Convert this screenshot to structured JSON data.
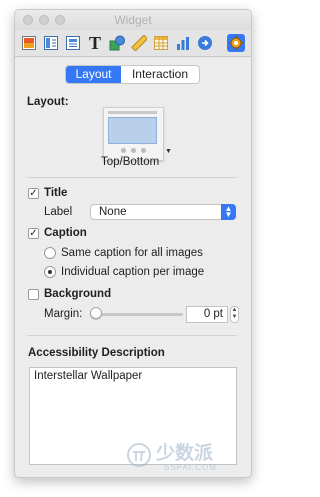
{
  "window": {
    "title": "Widget"
  },
  "toolbar": {
    "icons": [
      "image-icon",
      "layout-icon",
      "document-icon",
      "text-icon",
      "shapes-icon",
      "ruler-icon",
      "table-icon",
      "chart-icon",
      "link-icon",
      "gear-icon"
    ],
    "active": "gear-icon"
  },
  "tabs": {
    "layout": "Layout",
    "interaction": "Interaction",
    "selected": "Layout"
  },
  "layout": {
    "label": "Layout:",
    "preview_name": "Top/Bottom"
  },
  "title_section": {
    "checkbox_label": "Title",
    "checked": true,
    "label_label": "Label",
    "label_value": "None"
  },
  "caption_section": {
    "checkbox_label": "Caption",
    "checked": true,
    "options": [
      "Same caption for all images",
      "Individual caption per image"
    ],
    "selected_index": 1
  },
  "background_section": {
    "checkbox_label": "Background",
    "checked": false,
    "margin_label": "Margin:",
    "margin_value": "0 pt",
    "slider_fraction": 0
  },
  "accessibility": {
    "heading": "Accessibility Description",
    "value": "Interstellar Wallpaper"
  },
  "watermark": {
    "text": "少数派",
    "subtext": "SSPAI.COM"
  },
  "colors": {
    "accent": "#3478f6",
    "panel": "#ececec"
  }
}
